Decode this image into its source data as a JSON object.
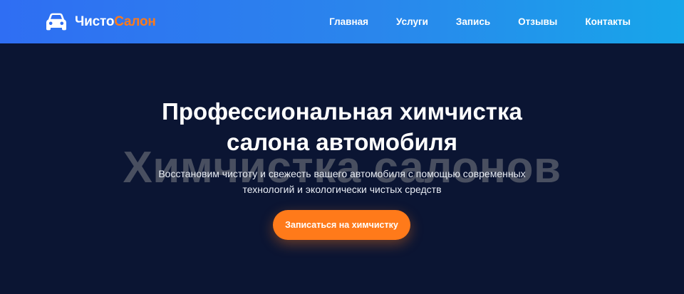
{
  "header": {
    "logo": {
      "icon": "car-icon",
      "part1": "Чисто",
      "part2": "Салон",
      "color_part1": "#ffffff",
      "color_part2": "#ff7a1a"
    },
    "nav": [
      {
        "label": "Главная"
      },
      {
        "label": "Услуги"
      },
      {
        "label": "Запись"
      },
      {
        "label": "Отзывы"
      },
      {
        "label": "Контакты"
      }
    ],
    "gradient_colors": [
      "#2f6ef3",
      "#17a6ea"
    ]
  },
  "hero": {
    "watermark": "Химчистка салонов",
    "title_line1": "Профессиональная химчистка",
    "title_line2": "салона автомобиля",
    "subtitle_line1": "Восстановим чистоту и свежесть вашего автомобиля с помощью современных",
    "subtitle_line2": "технологий и экологически чистых средств",
    "cta_label": "Записаться на химчистку",
    "background_color": "#0b1533",
    "accent_color": "#ff7a1a"
  }
}
